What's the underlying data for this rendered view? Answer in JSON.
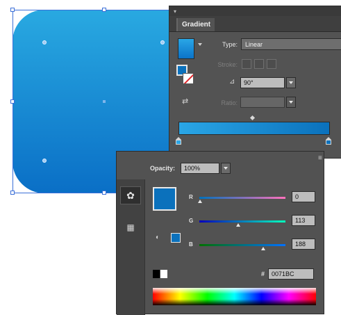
{
  "gradient_panel": {
    "tab_label": "Gradient",
    "type_label": "Type:",
    "type_value": "Linear",
    "stroke_label": "Stroke:",
    "angle_value": "90°",
    "ratio_label": "Ratio:",
    "stops": [
      {
        "color": "#2aa6e6",
        "location_pct": 0
      },
      {
        "color": "#0b71bc",
        "location_pct": 100
      }
    ]
  },
  "color_panel": {
    "opacity_label": "Opacity:",
    "opacity_value": "100%",
    "channels": [
      {
        "label": "R",
        "value": "0"
      },
      {
        "label": "G",
        "value": "113"
      },
      {
        "label": "B",
        "value": "188"
      }
    ],
    "hex_prefix": "#",
    "hex_value": "0071BC",
    "fill_color": "#0071bc"
  },
  "icons": {
    "panel_grip": "grip-icon",
    "panel_menu": "panel-menu-icon",
    "reverse_gradient": "reverse-gradient-icon",
    "angle": "angle-icon",
    "palette": "palette-icon",
    "swatches": "swatches-icon"
  },
  "canvas": {
    "shape_gradient_top": "#29a9e1",
    "shape_gradient_bottom": "#0a6fc6"
  }
}
